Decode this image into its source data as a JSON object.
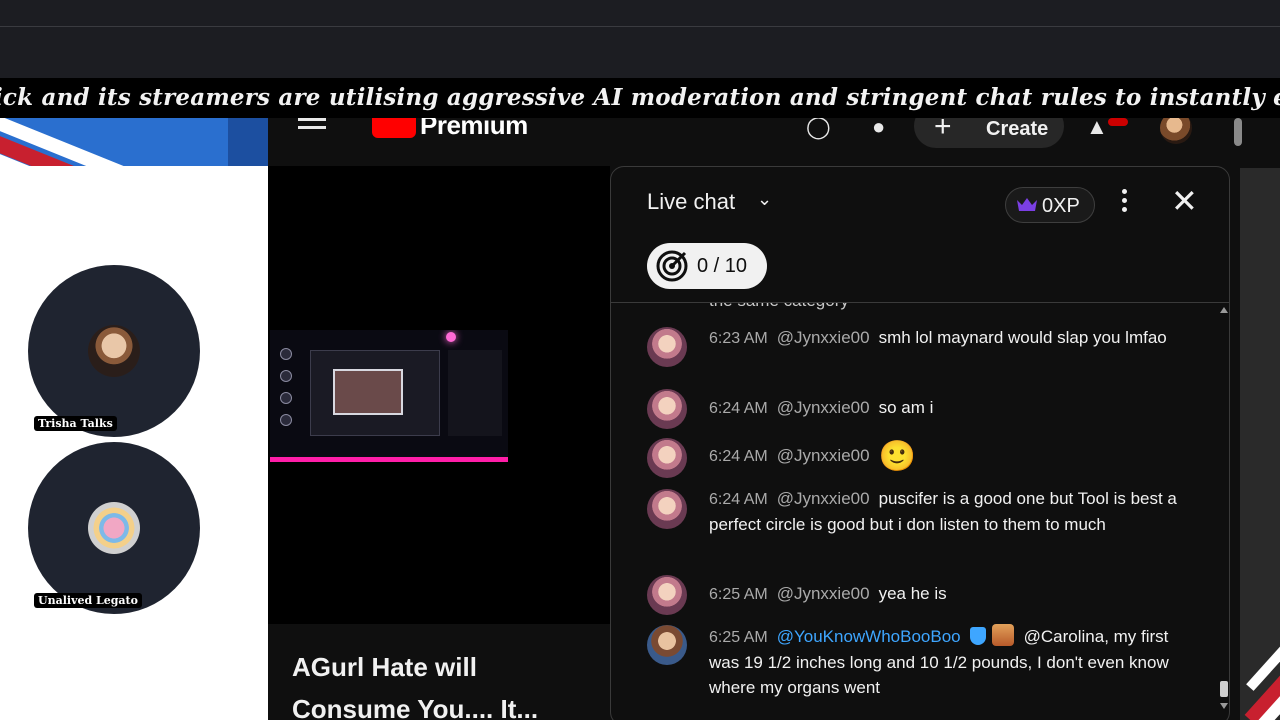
{
  "ticker": {
    "text": "ick and its streamers are utilising aggressive AI moderation and stringent chat rules to instantly eliminate high-"
  },
  "guests": [
    {
      "name": "Trisha Talks"
    },
    {
      "name": "Unalived Legato"
    }
  ],
  "youtube": {
    "logo_text": "Premium",
    "create_label": "Create",
    "video_title": "AGurl Hate will Consume You.... It..."
  },
  "chat": {
    "title": "Live chat",
    "xp_label": "0XP",
    "goal_label": "0 / 10",
    "cutoff_text": "the same category",
    "messages": [
      {
        "time": "6:23 AM",
        "author": "@Jynxxie00",
        "text": "smh lol maynard would slap you lmfao"
      },
      {
        "time": "6:24 AM",
        "author": "@Jynxxie00",
        "text": "so am i"
      },
      {
        "time": "6:24 AM",
        "author": "@Jynxxie00",
        "text": "🙂"
      },
      {
        "time": "6:24 AM",
        "author": "@Jynxxie00",
        "text": "puscifer is a good one but Tool is best a perfect circle is good but i don listen to them to much"
      },
      {
        "time": "6:25 AM",
        "author": "@Jynxxie00",
        "text": "yea he is"
      },
      {
        "time": "6:25 AM",
        "author": "@YouKnowWhoBooBoo",
        "text": "@Carolina, my first was 19 1/2 inches long and 10 1/2 pounds, I don't even know where my organs went"
      }
    ]
  },
  "colors": {
    "background": "#0f0f0f",
    "accent_red": "#ff0000",
    "moderator_blue": "#3ea6ff",
    "crown_purple": "#7b3fe4"
  }
}
